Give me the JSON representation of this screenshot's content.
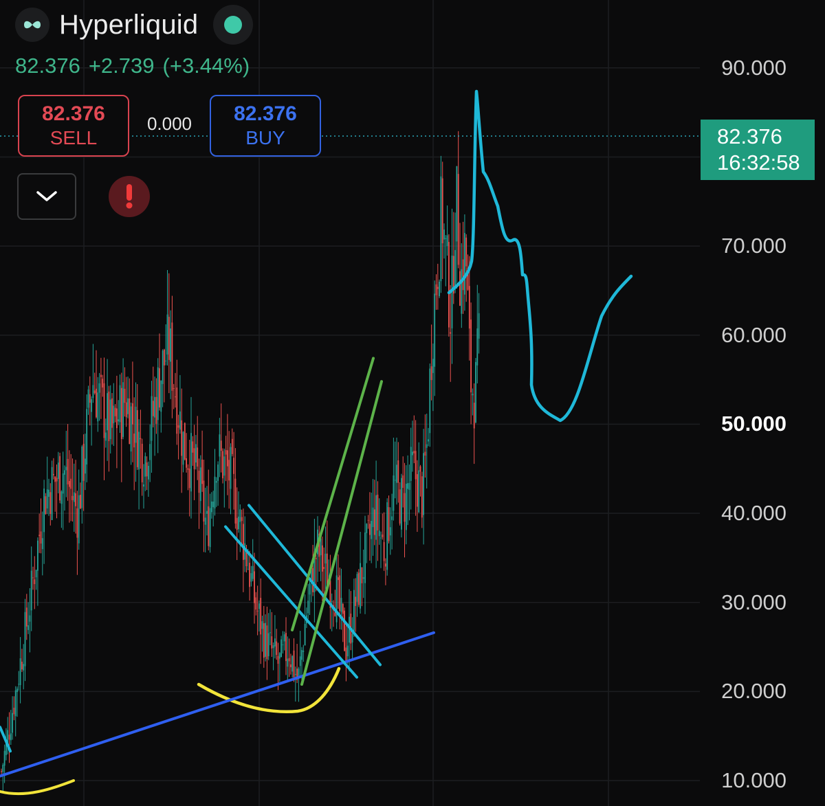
{
  "header": {
    "symbol": "Hyperliquid",
    "last_price": "82.376",
    "change": "+2.739",
    "change_pct": "(+3.44%)"
  },
  "trade": {
    "sell_price": "82.376",
    "sell_label": "SELL",
    "spread": "0.000",
    "buy_price": "82.376",
    "buy_label": "BUY"
  },
  "icons": {
    "logo": "hyperliquid-logo-icon",
    "status": "status-dot-icon",
    "dropdown": "chevron-down-icon",
    "alert": "alert-icon"
  },
  "price_tag": {
    "value": "82.376",
    "countdown": "16:32:58"
  },
  "axis": {
    "labels": [
      {
        "text": "90.000",
        "value": 90,
        "bold": false
      },
      {
        "text": "70.000",
        "value": 70,
        "bold": false
      },
      {
        "text": "60.000",
        "value": 60,
        "bold": false
      },
      {
        "text": "50.000",
        "value": 50,
        "bold": true
      },
      {
        "text": "40.000",
        "value": 40,
        "bold": false
      },
      {
        "text": "30.000",
        "value": 30,
        "bold": false
      },
      {
        "text": "20.000",
        "value": 20,
        "bold": false
      },
      {
        "text": "10.000",
        "value": 10,
        "bold": false
      }
    ]
  },
  "colors": {
    "background": "#0b0b0c",
    "up": "#26a69a",
    "down": "#ef5350",
    "accent_green": "#3fb68b",
    "sell": "#e34a55",
    "buy": "#3c72f0",
    "drawing_cyan": "#1fb8d8",
    "drawing_green": "#5db34a",
    "drawing_blue": "#2f5ff0",
    "drawing_yellow": "#f2e43a"
  },
  "chart_data": {
    "type": "candlestick",
    "title": "",
    "xlabel": "",
    "ylabel": "",
    "ylim": [
      6,
      98
    ],
    "grid": true,
    "current_price": 82.376,
    "anchors": [
      [
        0,
        11
      ],
      [
        0.03,
        20
      ],
      [
        0.06,
        30
      ],
      [
        0.09,
        42
      ],
      [
        0.13,
        45
      ],
      [
        0.16,
        40
      ],
      [
        0.19,
        55
      ],
      [
        0.23,
        49
      ],
      [
        0.26,
        53
      ],
      [
        0.3,
        46
      ],
      [
        0.33,
        55
      ],
      [
        0.35,
        59
      ],
      [
        0.38,
        48
      ],
      [
        0.41,
        44
      ],
      [
        0.43,
        38
      ],
      [
        0.45,
        47
      ],
      [
        0.48,
        44
      ],
      [
        0.51,
        36
      ],
      [
        0.53,
        30
      ],
      [
        0.55,
        26
      ],
      [
        0.58,
        23
      ],
      [
        0.6,
        25
      ],
      [
        0.62,
        21
      ],
      [
        0.64,
        30
      ],
      [
        0.66,
        36
      ],
      [
        0.68,
        33
      ],
      [
        0.7,
        31
      ],
      [
        0.72,
        25
      ],
      [
        0.74,
        30
      ],
      [
        0.76,
        35
      ],
      [
        0.78,
        40
      ],
      [
        0.8,
        36
      ],
      [
        0.82,
        43
      ],
      [
        0.84,
        41
      ],
      [
        0.86,
        45
      ],
      [
        0.88,
        42
      ],
      [
        0.89,
        48
      ],
      [
        0.9,
        60
      ],
      [
        0.92,
        74
      ],
      [
        0.94,
        62
      ],
      [
        0.95,
        76
      ],
      [
        0.96,
        66
      ],
      [
        0.97,
        70
      ],
      [
        0.975,
        63
      ],
      [
        0.98,
        55
      ],
      [
        0.99,
        53
      ],
      [
        0.995,
        57
      ],
      [
        1,
        60
      ]
    ],
    "drawings": [
      {
        "name": "blue-support-line",
        "color": "#2f5ff0",
        "points": [
          [
            0,
            10.5
          ],
          [
            631,
            26.6
          ]
        ]
      },
      {
        "name": "cyan-channel-line-upper",
        "color": "#1fb8d8",
        "points": [
          [
            362,
            40.9
          ],
          [
            553,
            23.0
          ]
        ]
      },
      {
        "name": "cyan-channel-line-lower",
        "color": "#1fb8d8",
        "points": [
          [
            328,
            38.5
          ],
          [
            519,
            21.6
          ]
        ]
      },
      {
        "name": "green-channel-line-left",
        "color": "#5db34a",
        "points": [
          [
            425,
            26.9
          ],
          [
            543,
            57.4
          ]
        ]
      },
      {
        "name": "green-channel-line-right",
        "color": "#5db34a",
        "points": [
          [
            439,
            20.8
          ],
          [
            555,
            54.8
          ]
        ]
      },
      {
        "name": "cyan-left-stub",
        "color": "#1fb8d8",
        "points": [
          [
            0,
            16
          ],
          [
            15,
            13.3
          ]
        ]
      }
    ]
  }
}
